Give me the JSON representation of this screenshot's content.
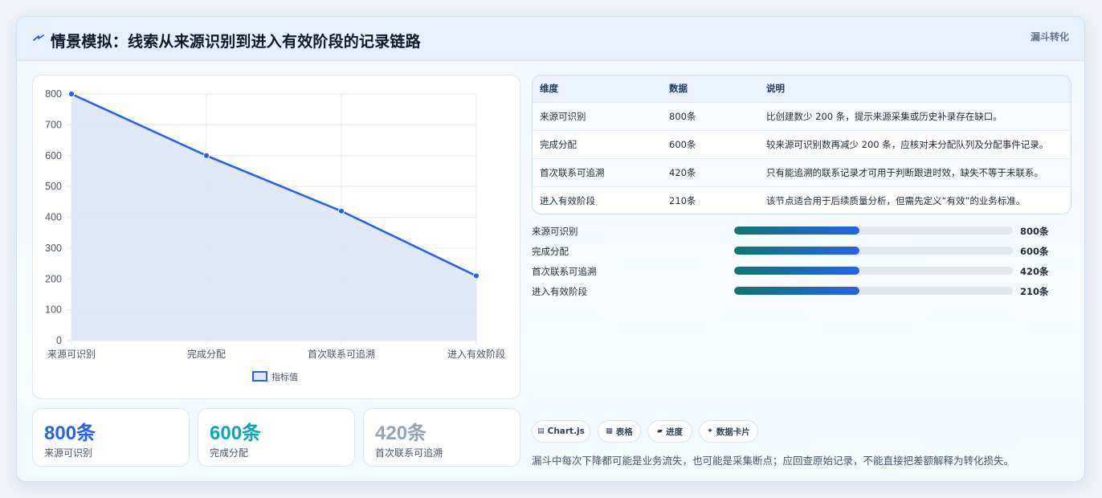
{
  "header": {
    "title": "情景模拟：线索从来源识别到进入有效阶段的记录链路",
    "badge": "漏斗转化",
    "icon": "lightning-icon"
  },
  "chart_data": {
    "type": "area",
    "categories": [
      "来源可识别",
      "完成分配",
      "首次联系可追溯",
      "进入有效阶段"
    ],
    "series": [
      {
        "name": "指标值",
        "values": [
          800,
          600,
          420,
          210
        ]
      }
    ],
    "ylim": [
      0,
      800
    ],
    "yticks": [
      "0",
      "100",
      "200",
      "300",
      "400",
      "500",
      "600",
      "700",
      "800"
    ],
    "grid": true,
    "legend": "bottom",
    "colors": {
      "line": "#2563eb",
      "fill": "#dfe7fa"
    }
  },
  "stats": [
    {
      "value": "800条",
      "label": "来源可识别",
      "color": "#2563eb"
    },
    {
      "value": "600条",
      "label": "完成分配",
      "color": "#0ea5b7"
    },
    {
      "value": "420条",
      "label": "首次联系可追溯",
      "color": "#94a3b8"
    }
  ],
  "table": {
    "headers": [
      "维度",
      "数据",
      "说明"
    ],
    "rows": [
      [
        "来源可识别",
        "800条",
        "比创建数少 200 条，提示来源采集或历史补录存在缺口。"
      ],
      [
        "完成分配",
        "600条",
        "较来源可识别数再减少 200 条，应核对未分配队列及分配事件记录。"
      ],
      [
        "首次联系可追溯",
        "420条",
        "只有能追溯的联系记录才可用于判断跟进时效，缺失不等于未联系。"
      ],
      [
        "进入有效阶段",
        "210条",
        "该节点适合用于后续质量分析，但需先定义“有效”的业务标准。"
      ]
    ]
  },
  "progress": [
    {
      "label": "来源可识别",
      "value": "800条",
      "fraction": 0.45
    },
    {
      "label": "完成分配",
      "value": "600条",
      "fraction": 0.45
    },
    {
      "label": "首次联系可追溯",
      "value": "420条",
      "fraction": 0.45
    },
    {
      "label": "进入有效阶段",
      "value": "210条",
      "fraction": 0.45
    }
  ],
  "chips": [
    {
      "icon": "chart-icon",
      "label": "Chart.js"
    },
    {
      "icon": "table-icon",
      "label": "表格"
    },
    {
      "icon": "progress-icon",
      "label": "进度"
    },
    {
      "icon": "sparkle-icon",
      "label": "数据卡片"
    }
  ],
  "note": "漏斗中每次下降都可能是业务流失，也可能是采集断点；应回查原始记录，不能直接把差额解释为转化损失。"
}
